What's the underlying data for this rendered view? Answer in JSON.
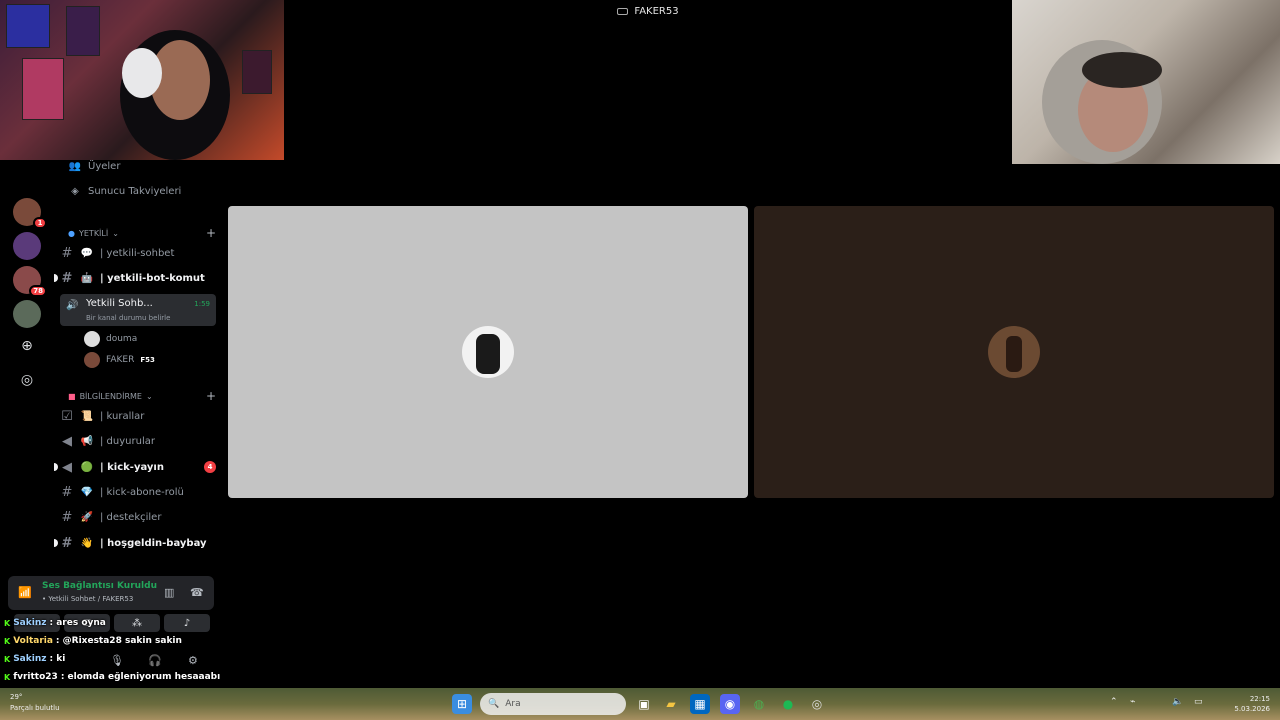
{
  "window": {
    "title": "FAKER53"
  },
  "sidebar": {
    "top_items": [
      {
        "label": "Üyeler",
        "icon": "members-icon"
      },
      {
        "label": "Sunucu Takviyeleri",
        "icon": "boost-icon"
      }
    ],
    "categories": [
      {
        "label": "YETKİLİ",
        "channels": [
          {
            "label": "| yetkili-sohbet",
            "emoji": "💬",
            "type": "text",
            "bold": false
          },
          {
            "label": "| yetkili-bot-komut",
            "emoji": "🤖",
            "type": "text",
            "bold": true
          }
        ]
      }
    ],
    "voice_channel": {
      "label": "Yetkili Sohb...",
      "timer": "1:59",
      "status": "Bir kanal durumu belirle",
      "members": [
        {
          "name": "douma",
          "tag": ""
        },
        {
          "name": "FAKER",
          "tag": "F53"
        }
      ]
    },
    "info_category": {
      "label": "BİLGİLENDİRME",
      "channels": [
        {
          "label": "| kurallar",
          "emoji": "📜",
          "type": "rules",
          "bold": false,
          "mentions": ""
        },
        {
          "label": "| duyurular",
          "emoji": "📢",
          "type": "announce",
          "bold": false,
          "mentions": ""
        },
        {
          "label": "| kick-yayın",
          "emoji": "🟢",
          "type": "announce",
          "bold": true,
          "mentions": "4"
        },
        {
          "label": "| kick-abone-rolü",
          "emoji": "💎",
          "type": "text",
          "bold": false,
          "mentions": ""
        },
        {
          "label": "| destekçiler",
          "emoji": "🚀",
          "type": "text",
          "bold": false,
          "mentions": ""
        },
        {
          "label": "| hoşgeldin-baybay",
          "emoji": "👋",
          "type": "text",
          "bold": true,
          "mentions": ""
        }
      ]
    }
  },
  "servers": [
    {
      "badge": "1"
    },
    {
      "badge": ""
    },
    {
      "badge": "78"
    },
    {
      "badge": ""
    }
  ],
  "voice_panel": {
    "title": "Ses Bağlantısı Kuruldu",
    "subtitle": "• Yetkili Sohbet / FAKER53"
  },
  "chat": [
    {
      "user": "Sakinz",
      "message": ": ares oyna"
    },
    {
      "user": "Voltaria",
      "message": ": @Rixesta28 sakin sakin"
    },
    {
      "user": "Sakinz",
      "message": ": ki"
    },
    {
      "user": "fvritto23",
      "message": ": elomda eğleniyorum hesaaabı"
    }
  ],
  "taskbar": {
    "search_placeholder": "Ara",
    "weather_temp": "29°",
    "weather_label": "Parçalı bulutlu",
    "time": "22:15",
    "date": "5.03.2026"
  },
  "colors": {
    "accent_green": "#23a55a",
    "mention_red": "#f23f43",
    "kick_green": "#53fc18"
  }
}
